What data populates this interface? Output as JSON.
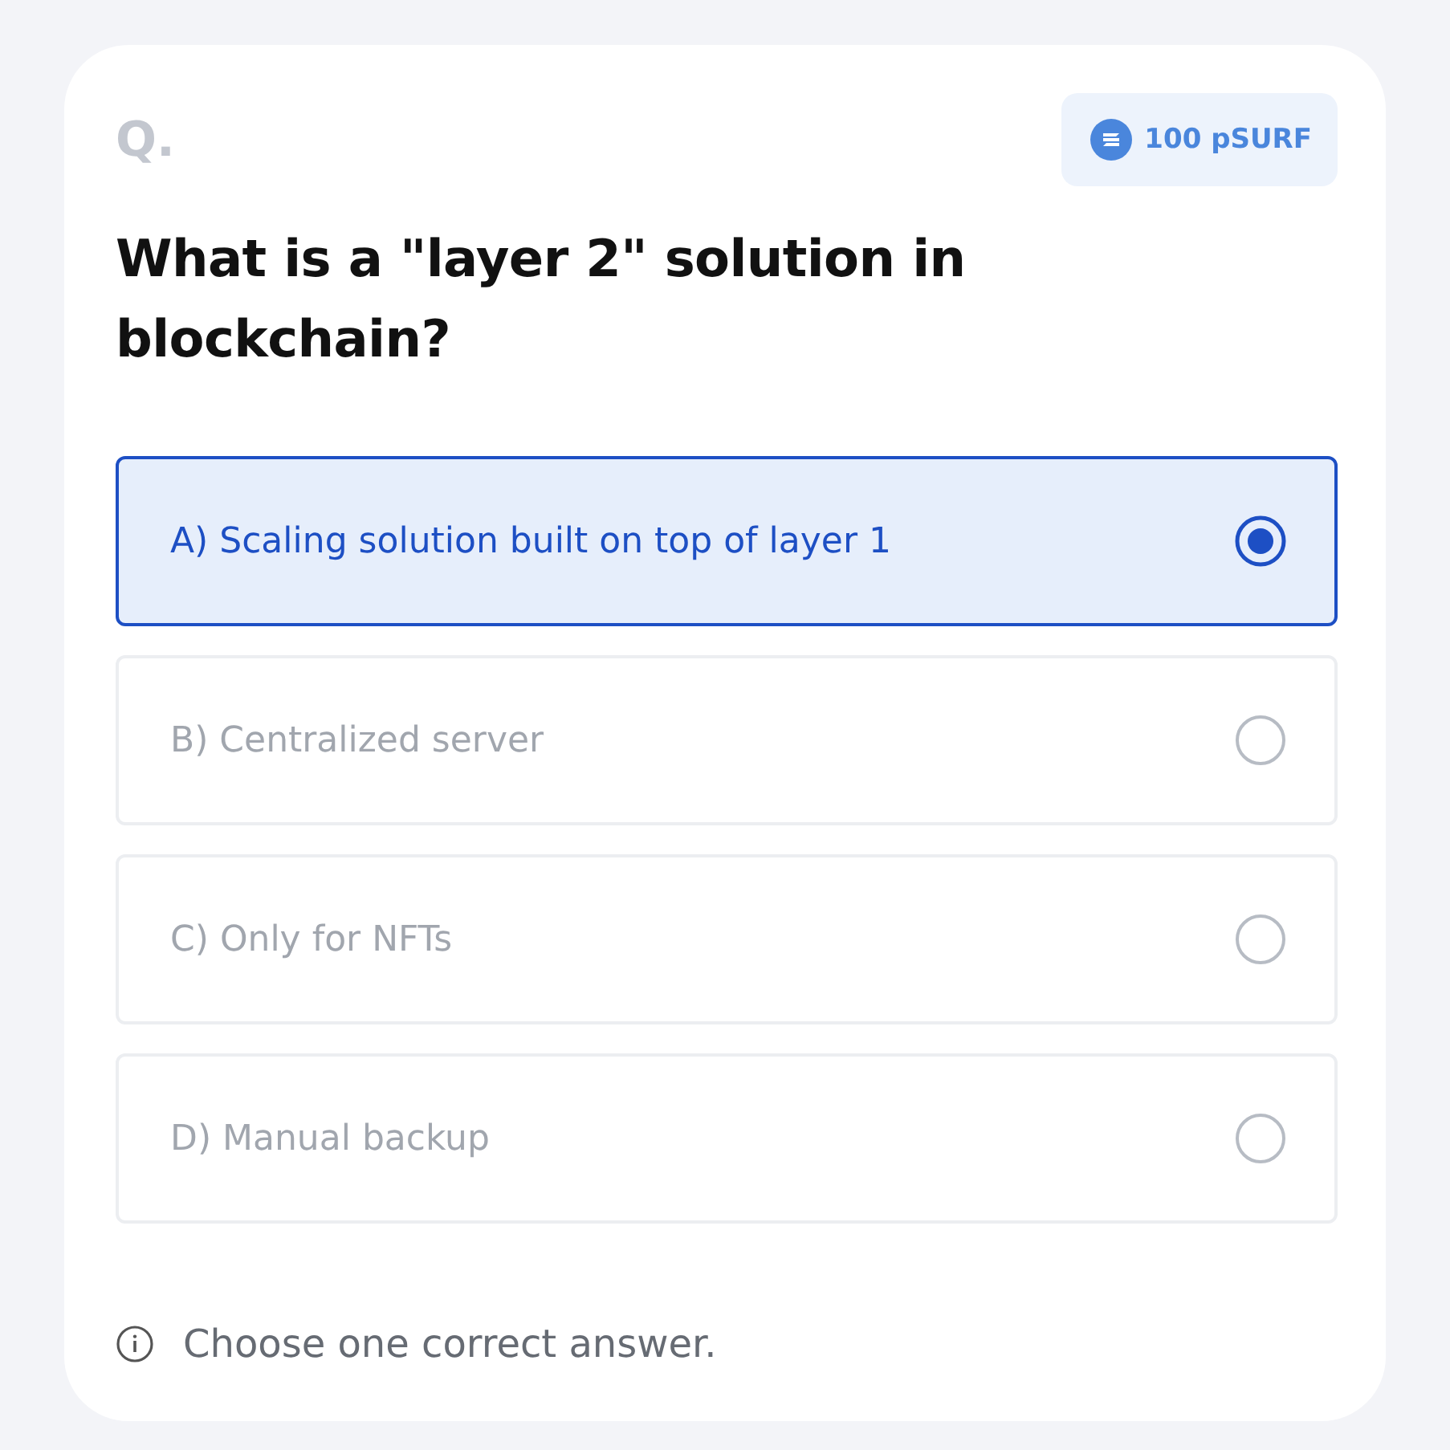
{
  "question_label": "Q.",
  "reward": {
    "text": "100 pSURF"
  },
  "question": "What is a \"layer 2\" solution in blockchain?",
  "options": [
    {
      "label": "A) Scaling solution built on top of layer 1",
      "selected": true
    },
    {
      "label": "B) Centralized server",
      "selected": false
    },
    {
      "label": "C) Only for NFTs",
      "selected": false
    },
    {
      "label": "D) Manual backup",
      "selected": false
    }
  ],
  "hint": "Choose one correct answer."
}
